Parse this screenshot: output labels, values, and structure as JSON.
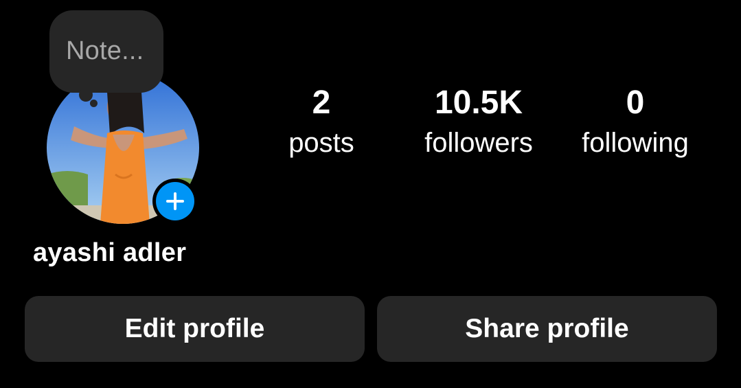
{
  "profile": {
    "username": "ayashi adler",
    "note_placeholder": "Note...",
    "avatar_icon": "profile-photo",
    "add_story_icon": "plus-icon",
    "accent_color": "#0095f6"
  },
  "stats": {
    "posts": {
      "count": "2",
      "label": "posts"
    },
    "followers": {
      "count": "10.5K",
      "label": "followers"
    },
    "following": {
      "count": "0",
      "label": "following"
    }
  },
  "actions": {
    "edit_label": "Edit profile",
    "share_label": "Share profile"
  }
}
